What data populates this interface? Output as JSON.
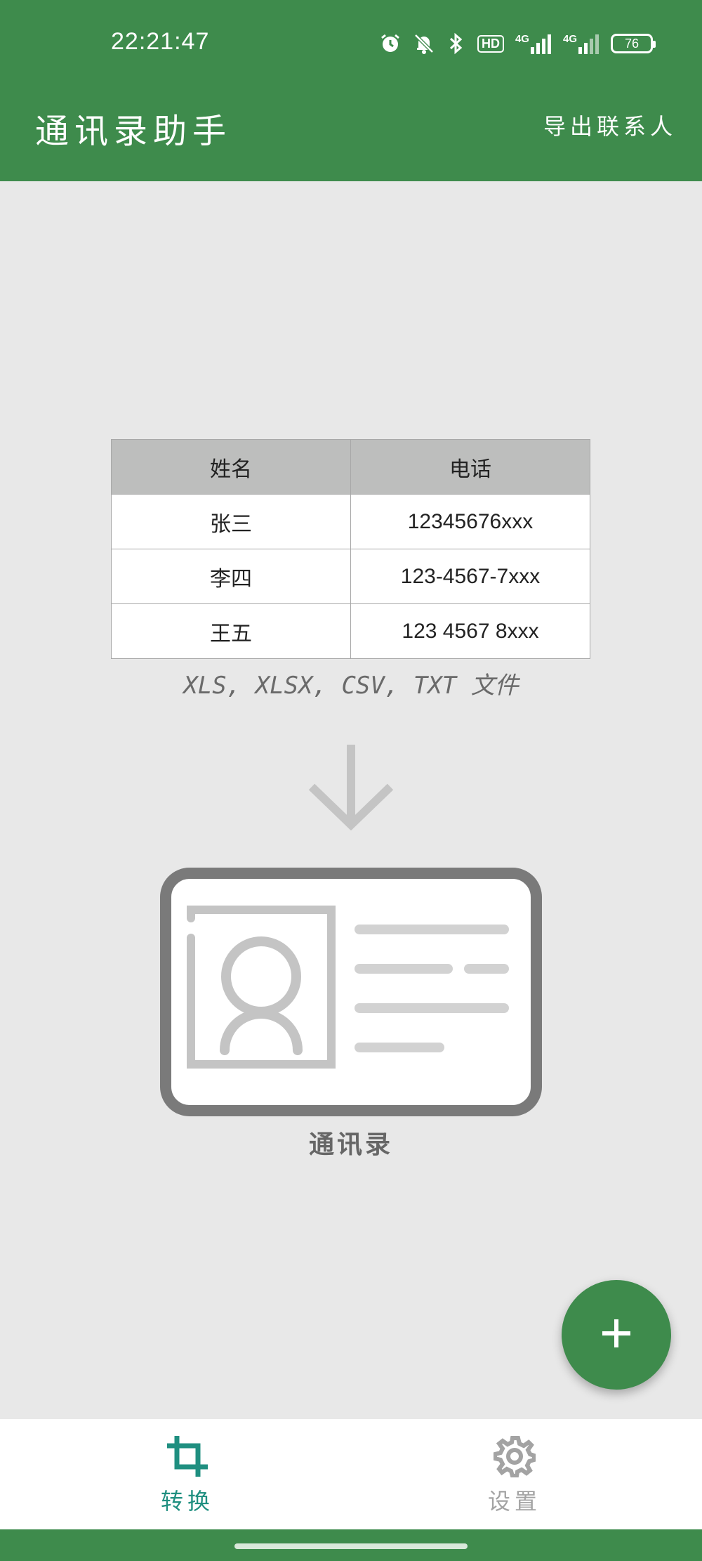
{
  "status_bar": {
    "time": "22:21:47",
    "icons": [
      "alarm-icon",
      "mute-icon",
      "bluetooth-icon",
      "hd-icon",
      "signal-4g-icon",
      "signal-4g-icon"
    ],
    "hd_label": "HD",
    "network_1": "4G",
    "network_2": "4G",
    "battery": "76"
  },
  "app_bar": {
    "title": "通讯录助手",
    "export_label": "导出联系人"
  },
  "sample_table": {
    "headers": [
      "姓名",
      "电话"
    ],
    "rows": [
      [
        "张三",
        "12345676xxx"
      ],
      [
        "李四",
        "123-4567-7xxx"
      ],
      [
        "王五",
        "123 4567 8xxx"
      ]
    ]
  },
  "formats_caption": "XLS, XLSX, CSV, TXT 文件",
  "contacts_caption": "通讯录",
  "fab": {
    "icon": "plus-icon"
  },
  "bottom_nav": {
    "items": [
      {
        "label": "转换",
        "icon": "crop-icon",
        "active": true
      },
      {
        "label": "设置",
        "icon": "gear-icon",
        "active": false
      }
    ]
  },
  "colors": {
    "primary": "#3e8b4c",
    "active_nav": "#1f8f80",
    "inactive_nav": "#a3a3a3",
    "background": "#e8e8e8"
  }
}
